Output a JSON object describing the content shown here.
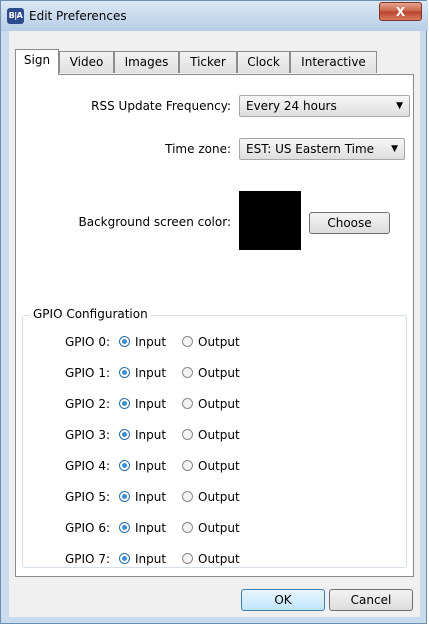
{
  "window": {
    "title": "Edit Preferences",
    "app_icon_text": "B|A",
    "close_glyph": "X"
  },
  "tabs": [
    {
      "label": "Sign",
      "active": true
    },
    {
      "label": "Video",
      "active": false
    },
    {
      "label": "Images",
      "active": false
    },
    {
      "label": "Ticker",
      "active": false
    },
    {
      "label": "Clock",
      "active": false
    },
    {
      "label": "Interactive",
      "active": false
    }
  ],
  "sign": {
    "rss_label": "RSS Update Frequency:",
    "rss_value": "Every 24 hours",
    "timezone_label": "Time zone:",
    "timezone_value": "EST: US Eastern Time",
    "bg_label": "Background screen color:",
    "bg_color": "#000000",
    "choose_label": "Choose"
  },
  "gpio": {
    "legend": "GPIO Configuration",
    "input_label": "Input",
    "output_label": "Output",
    "rows": [
      {
        "label": "GPIO 0:",
        "selected": "Input"
      },
      {
        "label": "GPIO 1:",
        "selected": "Input"
      },
      {
        "label": "GPIO 2:",
        "selected": "Input"
      },
      {
        "label": "GPIO 3:",
        "selected": "Input"
      },
      {
        "label": "GPIO 4:",
        "selected": "Input"
      },
      {
        "label": "GPIO 5:",
        "selected": "Input"
      },
      {
        "label": "GPIO 6:",
        "selected": "Input"
      },
      {
        "label": "GPIO 7:",
        "selected": "Input"
      }
    ]
  },
  "footer": {
    "ok_label": "OK",
    "cancel_label": "Cancel"
  }
}
